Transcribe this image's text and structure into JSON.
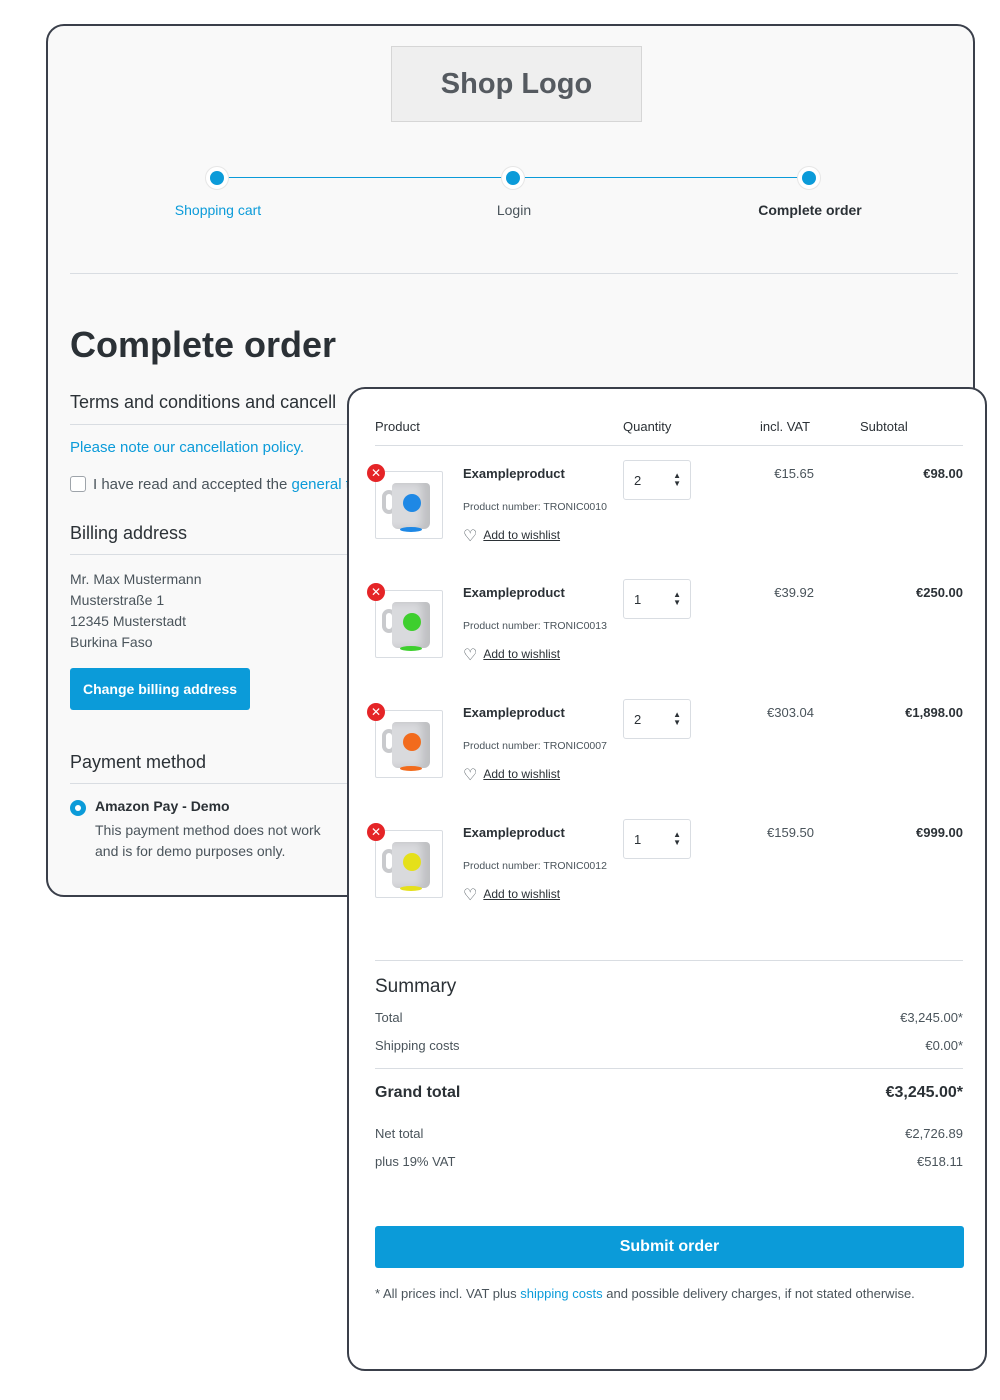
{
  "logo": {
    "text": "Shop Logo"
  },
  "steps": [
    {
      "label": "Shopping cart"
    },
    {
      "label": "Login"
    },
    {
      "label": "Complete order"
    }
  ],
  "page_title": "Complete order",
  "terms": {
    "title": "Terms and conditions and cancell",
    "cancellation_link": "Please note our cancellation policy.",
    "checkbox_text": "I have read and accepted the ",
    "checkbox_link": "general t"
  },
  "billing": {
    "title": "Billing address",
    "lines": [
      "Mr. Max Mustermann",
      "Musterstraße 1",
      "12345 Musterstadt",
      "Burkina Faso"
    ],
    "change_button": "Change billing address"
  },
  "payment": {
    "title": "Payment method",
    "selected": "Amazon Pay - Demo",
    "description": "This payment method does not work and is for demo purposes only."
  },
  "cart": {
    "headers": {
      "product": "Product",
      "quantity": "Quantity",
      "incl_vat": "incl. VAT",
      "subtotal": "Subtotal"
    },
    "remove_icon": "close-icon",
    "items": [
      {
        "name": "Exampleproduct",
        "number": "Product number: TRONIC0010",
        "wishlist": "Add to wishlist",
        "qty": "2",
        "price": "€15.65",
        "subtotal": "€98.00",
        "logo_color": "#1e88e5"
      },
      {
        "name": "Exampleproduct",
        "number": "Product number: TRONIC0013",
        "wishlist": "Add to wishlist",
        "qty": "1",
        "price": "€39.92",
        "subtotal": "€250.00",
        "logo_color": "#3ecf2e"
      },
      {
        "name": "Exampleproduct",
        "number": "Product number: TRONIC0007",
        "wishlist": "Add to wishlist",
        "qty": "2",
        "price": "€303.04",
        "subtotal": "€1,898.00",
        "logo_color": "#f26b1d"
      },
      {
        "name": "Exampleproduct",
        "number": "Product number: TRONIC0012",
        "wishlist": "Add to wishlist",
        "qty": "1",
        "price": "€159.50",
        "subtotal": "€999.00",
        "logo_color": "#e5e01a"
      }
    ]
  },
  "summary": {
    "title": "Summary",
    "total_label": "Total",
    "total_value": "€3,245.00*",
    "shipping_label": "Shipping costs",
    "shipping_value": "€0.00*",
    "grand_label": "Grand total",
    "grand_value": "€3,245.00*",
    "net_label": "Net total",
    "net_value": "€2,726.89",
    "vat_label": "plus 19% VAT",
    "vat_value": "€518.11"
  },
  "submit_button": "Submit order",
  "footnote": {
    "before": "* All prices incl. VAT plus ",
    "link": "shipping costs",
    "after": " and possible delivery charges, if not stated otherwise."
  },
  "colors": {
    "accent": "#0b9bd9",
    "remove": "#e52427",
    "text": "#4a545b",
    "heading": "#2b3136"
  }
}
